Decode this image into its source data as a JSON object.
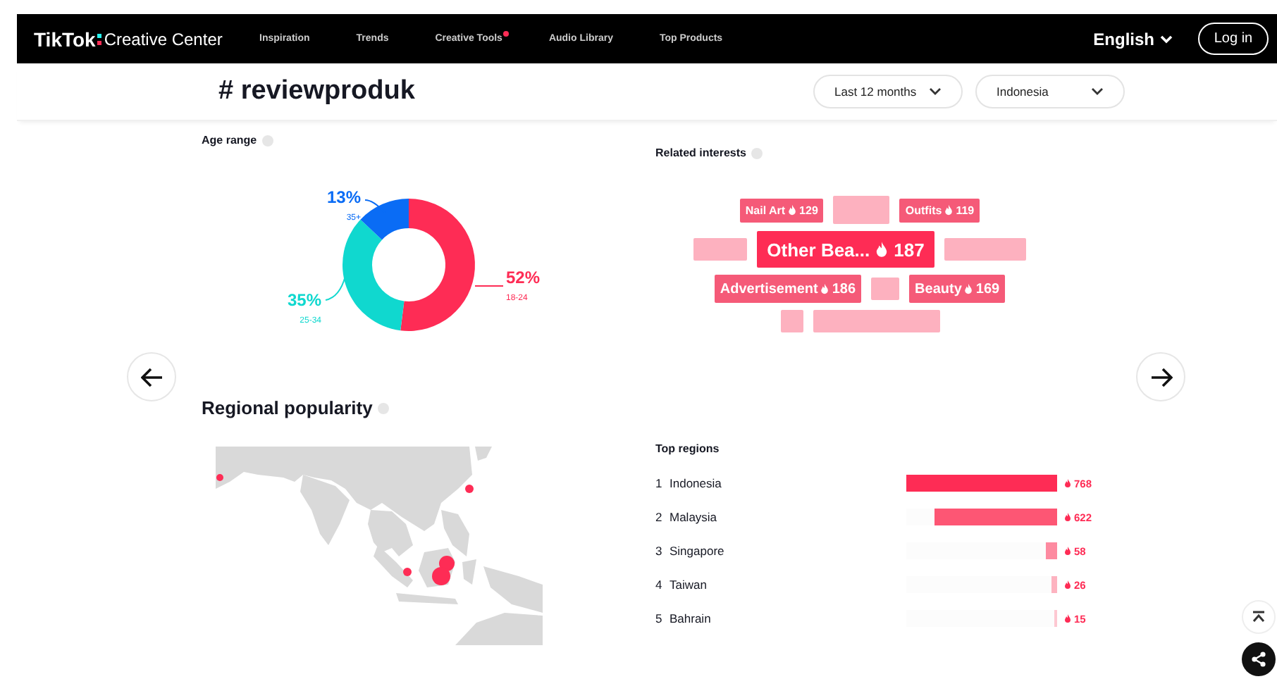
{
  "nav": {
    "brand": "TikTok",
    "product": "Creative Center",
    "items": [
      {
        "label": "Inspiration",
        "badge": false
      },
      {
        "label": "Trends",
        "badge": false
      },
      {
        "label": "Creative Tools",
        "badge": true
      },
      {
        "label": "Audio Library",
        "badge": false
      },
      {
        "label": "Top Products",
        "badge": false
      }
    ],
    "language": "English",
    "login": "Log in"
  },
  "header": {
    "title": "# reviewproduk",
    "filters": [
      "Last 12 months",
      "Indonesia"
    ]
  },
  "age_range": {
    "title": "Age range",
    "chart_data": {
      "type": "donut",
      "categories": [
        "18-24",
        "25-34",
        "35+"
      ],
      "values": [
        52,
        35,
        13
      ],
      "colors": [
        "#fe2c55",
        "#10d8cf",
        "#0a6cf5"
      ],
      "value_labels": [
        "52%",
        "35%",
        "13%"
      ]
    }
  },
  "related_interests": {
    "title": "Related interests",
    "rows": [
      {
        "items": [
          {
            "kind": "tag",
            "label": "Nail Art",
            "count": "129"
          },
          {
            "kind": "blank"
          },
          {
            "kind": "tag",
            "label": "Outfits",
            "count": "119"
          }
        ]
      },
      {
        "items": [
          {
            "kind": "blank"
          },
          {
            "kind": "featured",
            "label": "Other Bea...",
            "count": "187"
          },
          {
            "kind": "blank"
          }
        ]
      },
      {
        "items": [
          {
            "kind": "tag",
            "label": "Advertisement",
            "count": "186"
          },
          {
            "kind": "blank"
          },
          {
            "kind": "tag",
            "label": "Beauty",
            "count": "169"
          }
        ]
      },
      {
        "items": [
          {
            "kind": "blank"
          },
          {
            "kind": "blank"
          }
        ]
      }
    ]
  },
  "regional_popularity": {
    "title": "Regional popularity"
  },
  "top_regions": {
    "title": "Top regions",
    "rows": [
      {
        "rank": "1",
        "name": "Indonesia",
        "count": "768",
        "level": 1,
        "color": "#fe2c55"
      },
      {
        "rank": "2",
        "name": "Malaysia",
        "count": "622",
        "level": 0.81,
        "color": "#fd5674"
      },
      {
        "rank": "3",
        "name": "Singapore",
        "count": "58",
        "level": 0.076,
        "color": "#fd8aa0"
      },
      {
        "rank": "4",
        "name": "Taiwan",
        "count": "26",
        "level": 0.034,
        "color": "#fdb3c0"
      },
      {
        "rank": "5",
        "name": "Bahrain",
        "count": "15",
        "level": 0.02,
        "color": "#fdc8d2"
      }
    ]
  }
}
